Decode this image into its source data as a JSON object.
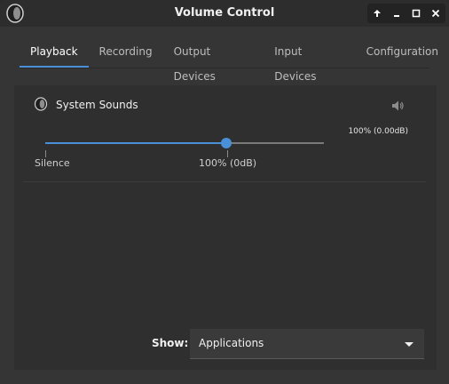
{
  "window": {
    "title": "Volume Control"
  },
  "tabs": [
    {
      "label": "Playback",
      "active": true
    },
    {
      "label": "Recording",
      "active": false
    },
    {
      "label": "Output Devices",
      "active": false
    },
    {
      "label": "Input Devices",
      "active": false
    },
    {
      "label": "Configuration",
      "active": false
    }
  ],
  "stream": {
    "name": "System Sounds",
    "volume_readout": "100% (0.00dB)",
    "volume_fraction": 0.65,
    "ticks": {
      "silence": "Silence",
      "normal": "100% (0dB)"
    }
  },
  "show": {
    "label": "Show:",
    "selected": "Applications"
  },
  "colors": {
    "accent": "#4a90d9",
    "background": "#353535"
  }
}
